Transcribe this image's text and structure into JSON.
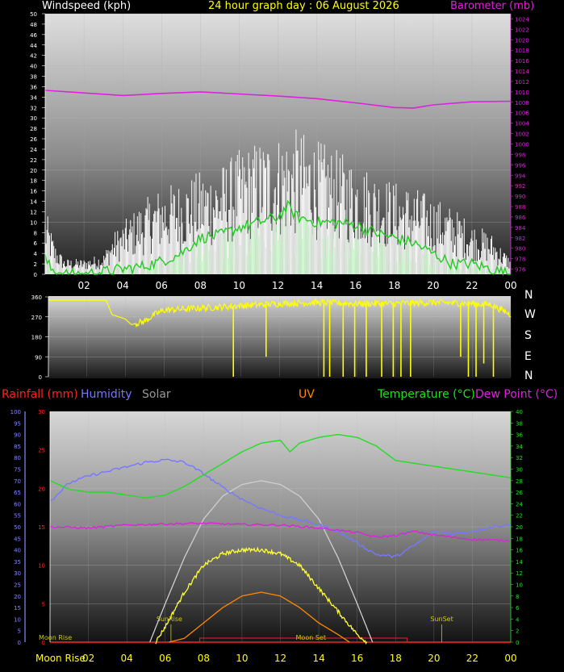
{
  "header": {
    "left": "Windspeed (kph)",
    "center": "24 hour graph day : 06 August 2026",
    "right": "Barometer (mb)"
  },
  "colors": {
    "windspeed_label": "#ffffff",
    "barometer": "#dd22dd",
    "direction": "#ffff00",
    "rainfall": "#ff2222",
    "humidity": "#7777ff",
    "solar": "#999999",
    "uv": "#ff8800",
    "temperature": "#22dd22",
    "dewpoint": "#dd22dd",
    "axis_blue": "#8888ff",
    "moon_label": "#ffff00",
    "sun_label": "#cccc00"
  },
  "compass": [
    "N",
    "W",
    "S",
    "E",
    "N"
  ],
  "labels3": {
    "rainfall": "Rainfall (mm)",
    "humidity": "Humidity",
    "solar": "Solar",
    "uv": "UV",
    "temperature": "Temperature (°C)",
    "dewpoint": "Dew Point (°C)"
  },
  "annotations": {
    "sunrise": "SunRise",
    "sunset": "SunSet",
    "moonrise_top": "Moon Rise",
    "moonset": "Moon Set",
    "moonrise_bottom": "Moon Rise"
  },
  "chart_data": [
    {
      "type": "line",
      "name": "wind",
      "x_tick_labels": [
        "02",
        "04",
        "06",
        "08",
        "10",
        "12",
        "14",
        "16",
        "18",
        "20",
        "22",
        "00"
      ],
      "y_left_ticks": [
        0,
        2,
        4,
        6,
        8,
        10,
        12,
        14,
        16,
        18,
        20,
        22,
        24,
        26,
        28,
        30,
        32,
        34,
        36,
        38,
        40,
        42,
        44,
        46,
        48,
        50
      ],
      "y_left_range": [
        0,
        50
      ],
      "y_right_ticks": [
        976,
        978,
        980,
        982,
        984,
        986,
        988,
        990,
        992,
        994,
        996,
        998,
        1000,
        1002,
        1004,
        1006,
        1008,
        1010,
        1012,
        1014,
        1016,
        1018,
        1020,
        1022,
        1024
      ],
      "y_right_range": [
        975,
        1025
      ],
      "gust_envelope": [
        [
          0,
          13
        ],
        [
          0.5,
          6
        ],
        [
          1,
          3
        ],
        [
          2,
          3
        ],
        [
          3,
          4
        ],
        [
          3.5,
          8
        ],
        [
          4,
          10
        ],
        [
          5,
          14
        ],
        [
          6,
          17
        ],
        [
          7,
          18
        ],
        [
          8,
          20
        ],
        [
          9,
          21
        ],
        [
          10,
          24
        ],
        [
          11,
          26
        ],
        [
          12,
          27
        ],
        [
          13,
          28
        ],
        [
          14,
          26
        ],
        [
          15,
          24
        ],
        [
          16,
          22
        ],
        [
          17,
          20
        ],
        [
          18,
          18
        ],
        [
          19,
          17
        ],
        [
          20,
          15
        ],
        [
          21,
          13
        ],
        [
          22,
          10
        ],
        [
          23,
          8
        ],
        [
          24,
          3
        ]
      ],
      "avg_wind": [
        [
          0,
          3
        ],
        [
          0.3,
          1
        ],
        [
          1,
          0
        ],
        [
          2,
          0
        ],
        [
          3,
          0.5
        ],
        [
          4,
          1
        ],
        [
          5,
          1.5
        ],
        [
          6,
          2.5
        ],
        [
          7,
          4
        ],
        [
          8,
          7
        ],
        [
          9,
          7.5
        ],
        [
          10,
          9
        ],
        [
          11,
          10
        ],
        [
          12,
          11
        ],
        [
          12.5,
          13
        ],
        [
          13,
          11
        ],
        [
          14,
          10
        ],
        [
          15,
          10
        ],
        [
          16,
          9.5
        ],
        [
          17,
          8
        ],
        [
          18,
          7
        ],
        [
          19,
          6
        ],
        [
          20,
          4
        ],
        [
          21,
          2
        ],
        [
          22,
          2
        ],
        [
          23,
          1
        ],
        [
          24,
          0
        ]
      ],
      "barometer": [
        [
          0,
          1010.3
        ],
        [
          2,
          1009.8
        ],
        [
          4,
          1009.3
        ],
        [
          6,
          1009.7
        ],
        [
          8,
          1010.0
        ],
        [
          10,
          1009.6
        ],
        [
          12,
          1009.2
        ],
        [
          14,
          1008.7
        ],
        [
          16,
          1007.9
        ],
        [
          18,
          1007.0
        ],
        [
          19,
          1006.9
        ],
        [
          20,
          1007.5
        ],
        [
          22,
          1008.1
        ],
        [
          24,
          1008.2
        ]
      ]
    },
    {
      "type": "line",
      "name": "wind_direction",
      "y_ticks": [
        0,
        90,
        180,
        270,
        360
      ],
      "y_range": [
        0,
        360
      ],
      "direction": [
        [
          0,
          345
        ],
        [
          3,
          345
        ],
        [
          3.3,
          280
        ],
        [
          4,
          260
        ],
        [
          4.3,
          235
        ],
        [
          5,
          250
        ],
        [
          5.5,
          280
        ],
        [
          6,
          300
        ],
        [
          8,
          310
        ],
        [
          10,
          320
        ],
        [
          12,
          330
        ],
        [
          14,
          335
        ],
        [
          16,
          330
        ],
        [
          18,
          330
        ],
        [
          20,
          335
        ],
        [
          22,
          330
        ],
        [
          23,
          325
        ],
        [
          24,
          280
        ]
      ],
      "drops": [
        [
          9.6,
          0
        ],
        [
          11.3,
          90
        ],
        [
          14.3,
          0
        ],
        [
          14.6,
          0
        ],
        [
          15.3,
          0
        ],
        [
          15.9,
          0
        ],
        [
          16.5,
          0
        ],
        [
          17.3,
          0
        ],
        [
          17.9,
          0
        ],
        [
          18.3,
          0
        ],
        [
          18.8,
          0
        ],
        [
          21.4,
          90
        ],
        [
          21.8,
          0
        ],
        [
          22.2,
          0
        ],
        [
          22.6,
          60
        ],
        [
          23.1,
          0
        ]
      ]
    },
    {
      "type": "line",
      "name": "multi",
      "x_tick_labels": [
        "Moon Rise",
        "02",
        "04",
        "06",
        "08",
        "10",
        "12",
        "14",
        "16",
        "18",
        "20",
        "22",
        "00"
      ],
      "y_left_ticks": [
        0,
        5,
        10,
        15,
        20,
        25,
        30,
        35,
        40,
        45,
        50,
        55,
        60,
        65,
        70,
        75,
        80,
        85,
        90,
        95,
        100
      ],
      "y_left_range": [
        0,
        100
      ],
      "y_mm_ticks": [
        0,
        5,
        10,
        15,
        20,
        25,
        30
      ],
      "y_mm_range": [
        0,
        30
      ],
      "y_right_ticks": [
        0,
        2,
        4,
        6,
        8,
        10,
        12,
        14,
        16,
        18,
        20,
        22,
        24,
        26,
        28,
        30,
        32,
        34,
        36,
        38,
        40
      ],
      "y_right_range": [
        0,
        40
      ],
      "humidity": [
        [
          0,
          61
        ],
        [
          1,
          69
        ],
        [
          2,
          72
        ],
        [
          3,
          74
        ],
        [
          4,
          76
        ],
        [
          5,
          78
        ],
        [
          6,
          79
        ],
        [
          7,
          78
        ],
        [
          8,
          73
        ],
        [
          9,
          67
        ],
        [
          10,
          62
        ],
        [
          11,
          58
        ],
        [
          12,
          55
        ],
        [
          13,
          53
        ],
        [
          14,
          51
        ],
        [
          15,
          48
        ],
        [
          16,
          43
        ],
        [
          17,
          38
        ],
        [
          18,
          37
        ],
        [
          19,
          42
        ],
        [
          20,
          48
        ],
        [
          21,
          47
        ],
        [
          22,
          48
        ],
        [
          23,
          50
        ],
        [
          24,
          51
        ]
      ],
      "temperature": [
        [
          0,
          28
        ],
        [
          1,
          26.5
        ],
        [
          2,
          26
        ],
        [
          3,
          26
        ],
        [
          4,
          25.5
        ],
        [
          5,
          25
        ],
        [
          6,
          25.5
        ],
        [
          7,
          27
        ],
        [
          8,
          29
        ],
        [
          9,
          31
        ],
        [
          10,
          33
        ],
        [
          11,
          34.5
        ],
        [
          12,
          35
        ],
        [
          12.5,
          33
        ],
        [
          13,
          34.5
        ],
        [
          14,
          35.5
        ],
        [
          15,
          36
        ],
        [
          16,
          35.5
        ],
        [
          17,
          34
        ],
        [
          18,
          31.5
        ],
        [
          19,
          31
        ],
        [
          20,
          30.5
        ],
        [
          21,
          30
        ],
        [
          22,
          29.5
        ],
        [
          23,
          29
        ],
        [
          24,
          28.5
        ]
      ],
      "dewpoint": [
        [
          0,
          20
        ],
        [
          2,
          19.8
        ],
        [
          4,
          20.3
        ],
        [
          6,
          20.5
        ],
        [
          8,
          20.6
        ],
        [
          10,
          20.4
        ],
        [
          12,
          20.3
        ],
        [
          14,
          19.8
        ],
        [
          16,
          19.0
        ],
        [
          17,
          18.2
        ],
        [
          18,
          18.5
        ],
        [
          19,
          19.2
        ],
        [
          20,
          18.6
        ],
        [
          22,
          17.8
        ],
        [
          24,
          17.6
        ]
      ],
      "solar_max": [
        [
          5.2,
          0
        ],
        [
          6,
          5
        ],
        [
          7,
          11
        ],
        [
          8,
          16
        ],
        [
          9,
          19
        ],
        [
          10,
          20.5
        ],
        [
          11,
          21
        ],
        [
          12,
          20.5
        ],
        [
          13,
          19
        ],
        [
          14,
          16
        ],
        [
          15,
          11
        ],
        [
          16,
          5
        ],
        [
          16.8,
          0
        ]
      ],
      "solar": [
        [
          5.5,
          0
        ],
        [
          6,
          2
        ],
        [
          7,
          6.5
        ],
        [
          8,
          10
        ],
        [
          9,
          11.5
        ],
        [
          10,
          12
        ],
        [
          11,
          12
        ],
        [
          12,
          11.5
        ],
        [
          13,
          10
        ],
        [
          14,
          7
        ],
        [
          15,
          4
        ],
        [
          16,
          1
        ],
        [
          16.5,
          0
        ]
      ],
      "uv": [
        [
          6.2,
          0
        ],
        [
          7,
          0.5
        ],
        [
          8,
          2.5
        ],
        [
          9,
          4.5
        ],
        [
          10,
          6
        ],
        [
          11,
          6.5
        ],
        [
          12,
          6
        ],
        [
          13,
          4.5
        ],
        [
          14,
          2.5
        ],
        [
          15,
          1
        ],
        [
          15.6,
          0
        ]
      ],
      "rainfall_total": 0,
      "sunrise_hour": 6.3,
      "sunset_hour": 20.4,
      "moonset_start": 7.8,
      "moonset_end": 18.6
    }
  ]
}
